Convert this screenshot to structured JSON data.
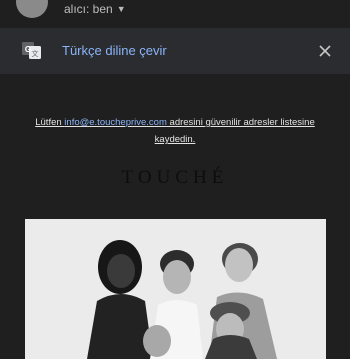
{
  "header": {
    "recipient": "alıcı: ben",
    "chevron_icon": "chevron-down"
  },
  "translate": {
    "label": "Türkçe diline çevir",
    "icon": "google-translate",
    "close_icon": "close"
  },
  "safe_notice": {
    "prefix": "Lütfen ",
    "email": "info@e.toucheprive.com",
    "suffix": " adresini güvenilir adresler listesine kaydedin."
  },
  "brand": {
    "logo_text": "TOUCHÉ"
  },
  "hero": {
    "image_alt": "five smiling women"
  },
  "colors": {
    "background": "#1f1f1f",
    "translate_bar": "#2b2c2f",
    "link": "#8ab4f8"
  }
}
